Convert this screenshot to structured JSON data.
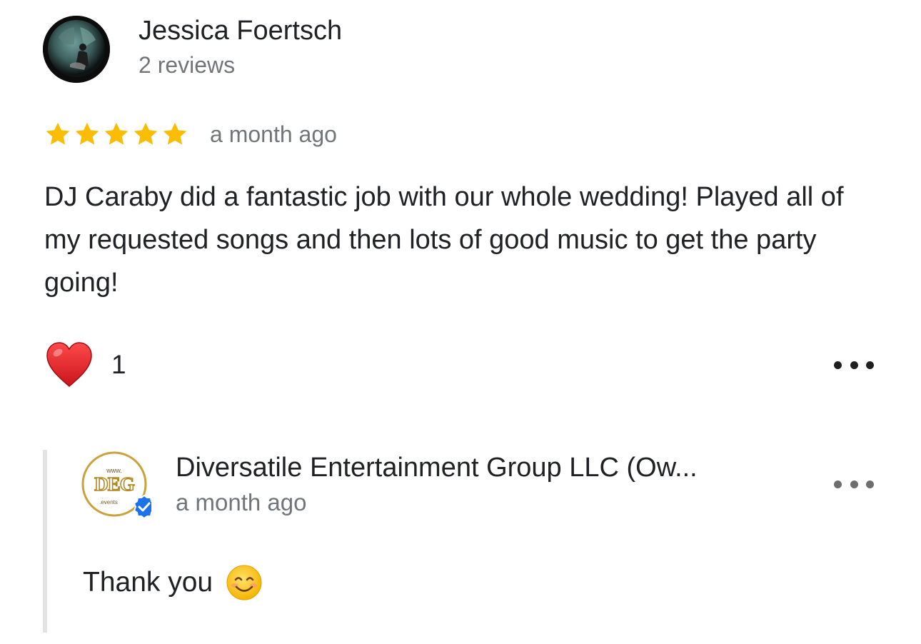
{
  "review": {
    "reviewer_name": "Jessica Foertsch",
    "reviewer_meta": "2 reviews",
    "rating": 5,
    "rating_max": 5,
    "date": "a month ago",
    "text": "DJ Caraby did a fantastic job with our whole wedding! Played all of my requested songs and then lots of good music to get the party going!",
    "like_count": "1",
    "like_icon": "heart-icon",
    "more_icon": "more-horizontal-icon"
  },
  "owner_reply": {
    "owner_name": "Diversatile Entertainment Group LLC (Ow...",
    "date": "a month ago",
    "text": "Thank you",
    "emoji": "smiling-face-icon",
    "logo_text": {
      "top": "www.",
      "main": "DEG",
      "bottom": ".events"
    },
    "verified_icon": "verified-badge-icon",
    "more_icon": "more-horizontal-icon"
  },
  "colors": {
    "star": "#fbbc04",
    "heart": "#e0202a",
    "verified": "#1a73e8",
    "logo_gold": "#c9a23a",
    "muted_text": "#70757a"
  }
}
